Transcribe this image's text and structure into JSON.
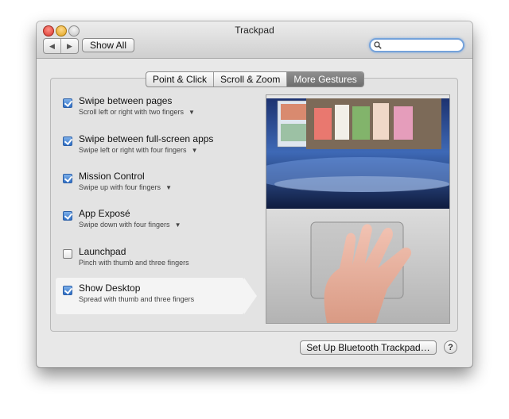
{
  "window": {
    "title": "Trackpad",
    "nav_back": "◀",
    "nav_forward": "▶",
    "show_all": "Show All",
    "search_placeholder": ""
  },
  "tabs": [
    {
      "label": "Point & Click",
      "active": false
    },
    {
      "label": "Scroll & Zoom",
      "active": false
    },
    {
      "label": "More Gestures",
      "active": true
    }
  ],
  "gestures": [
    {
      "title": "Swipe between pages",
      "subtitle": "Scroll left or right with two fingers",
      "checked": true,
      "has_menu": true
    },
    {
      "title": "Swipe between full-screen apps",
      "subtitle": "Swipe left or right with four fingers",
      "checked": true,
      "has_menu": true
    },
    {
      "title": "Mission Control",
      "subtitle": "Swipe up with four fingers",
      "checked": true,
      "has_menu": true
    },
    {
      "title": "App Exposé",
      "subtitle": "Swipe down with four fingers",
      "checked": true,
      "has_menu": true
    },
    {
      "title": "Launchpad",
      "subtitle": "Pinch with thumb and three fingers",
      "checked": false,
      "has_menu": false
    },
    {
      "title": "Show Desktop",
      "subtitle": "Spread with thumb and three fingers",
      "checked": true,
      "has_menu": false,
      "selected": true
    }
  ],
  "footer": {
    "bluetooth_button": "Set Up Bluetooth Trackpad…",
    "help": "?"
  },
  "icons": {
    "search": "search-icon",
    "menu_caret": "chevron-down-icon",
    "close": "close-icon",
    "minimize": "minimize-icon",
    "zoom": "zoom-icon"
  },
  "colors": {
    "accent_checkbox": "#2f6fc5",
    "active_tab": "#7c7c7c",
    "search_focus": "#74a2da"
  }
}
